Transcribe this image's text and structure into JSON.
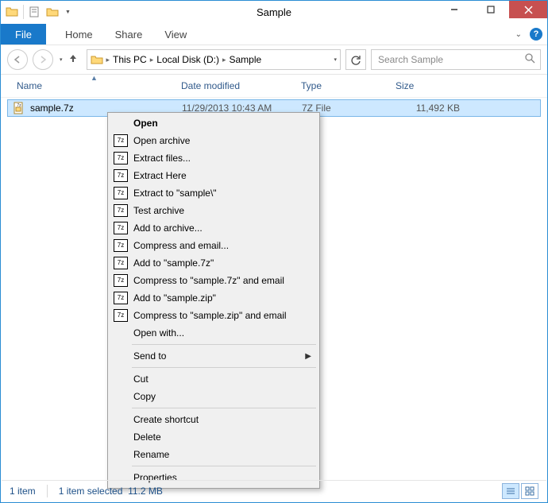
{
  "window": {
    "title": "Sample"
  },
  "ribbon": {
    "file_label": "File",
    "tabs": [
      "Home",
      "Share",
      "View"
    ]
  },
  "breadcrumb": {
    "items": [
      "This PC",
      "Local Disk (D:)",
      "Sample"
    ]
  },
  "search": {
    "placeholder": "Search Sample"
  },
  "columns": {
    "name": "Name",
    "date": "Date modified",
    "type": "Type",
    "size": "Size"
  },
  "files": [
    {
      "name": "sample.7z",
      "date": "11/29/2013 10:43 AM",
      "type": "7Z File",
      "size": "11,492 KB"
    }
  ],
  "context_menu": {
    "open": "Open",
    "open_archive": "Open archive",
    "extract_files": "Extract files...",
    "extract_here": "Extract Here",
    "extract_to": "Extract to \"sample\\\"",
    "test_archive": "Test archive",
    "add_to_archive": "Add to archive...",
    "compress_email": "Compress and email...",
    "add_to_7z": "Add to \"sample.7z\"",
    "compress_7z_email": "Compress to \"sample.7z\" and email",
    "add_to_zip": "Add to \"sample.zip\"",
    "compress_zip_email": "Compress to \"sample.zip\" and email",
    "open_with": "Open with...",
    "send_to": "Send to",
    "cut": "Cut",
    "copy": "Copy",
    "create_shortcut": "Create shortcut",
    "delete": "Delete",
    "rename": "Rename",
    "properties": "Properties"
  },
  "status": {
    "item_count": "1 item",
    "selection": "1 item selected",
    "selection_size": "11.2 MB"
  },
  "icons": {
    "sevenz_badge": "7z"
  }
}
